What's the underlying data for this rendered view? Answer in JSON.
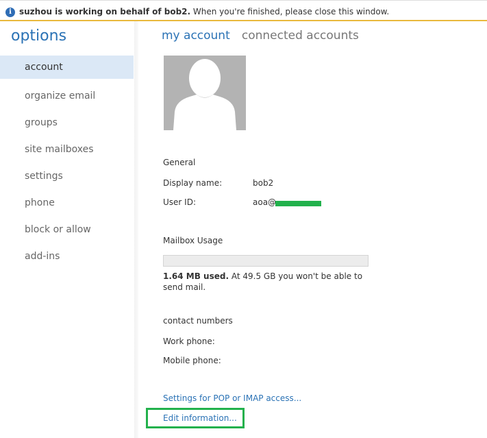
{
  "infobar": {
    "icon": "info-icon",
    "delegate_bold": "suzhou is working on behalf of bob2.",
    "message": " When you're finished, please close this window."
  },
  "sidebar": {
    "title": "options",
    "items": [
      {
        "label": "account",
        "selected": true
      },
      {
        "label": "organize email",
        "selected": false
      },
      {
        "label": "groups",
        "selected": false
      },
      {
        "label": "site mailboxes",
        "selected": false
      },
      {
        "label": "settings",
        "selected": false
      },
      {
        "label": "phone",
        "selected": false
      },
      {
        "label": "block or allow",
        "selected": false
      },
      {
        "label": "add-ins",
        "selected": false
      }
    ]
  },
  "main": {
    "tabs": [
      {
        "label": "my account",
        "active": true
      },
      {
        "label": "connected accounts",
        "active": false
      }
    ],
    "general": {
      "heading": "General",
      "display_name_label": "Display name:",
      "display_name_value": "bob2",
      "user_id_label": "User ID:",
      "user_id_value": "aoa@"
    },
    "mailbox": {
      "heading": "Mailbox Usage",
      "used_bold": "1.64 MB used.",
      "used_text": " At 49.5 GB you won't be able to send mail.",
      "usage_fraction": 3e-05
    },
    "contact": {
      "heading": "contact numbers",
      "work_phone_label": "Work phone:",
      "mobile_phone_label": "Mobile phone:"
    },
    "links": {
      "pop_imap": "Settings for POP or IMAP access...",
      "edit_info": "Edit information..."
    }
  },
  "colors": {
    "accent": "#2a72b5",
    "selected_bg": "#dbe8f6",
    "highlight": "#22b14c",
    "infobar_border": "#e9b93c"
  }
}
